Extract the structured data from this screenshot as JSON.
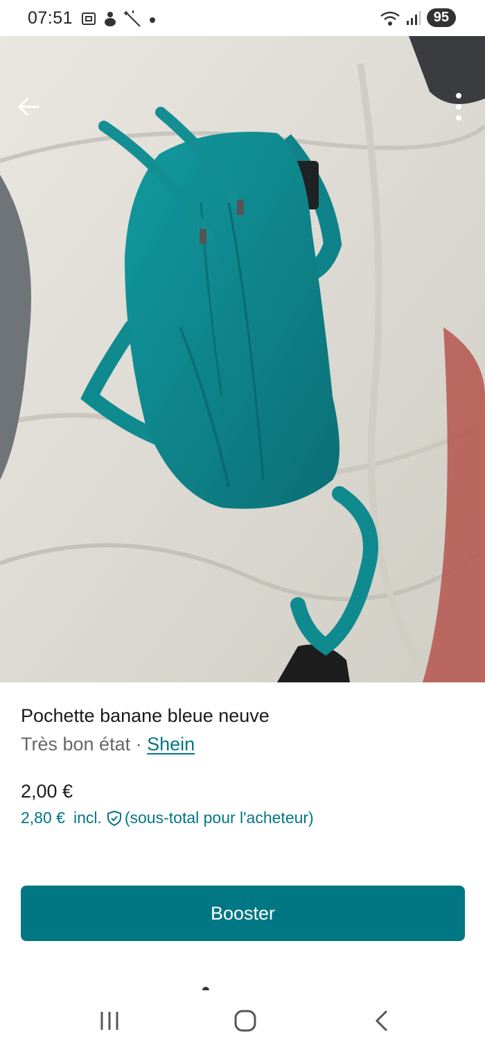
{
  "status_bar": {
    "time": "07:51",
    "battery": "95",
    "icons": [
      "screenshot-icon",
      "notification-app-icon",
      "magic-wand-icon",
      "dot-icon",
      "wifi-icon",
      "signal-icon"
    ]
  },
  "header": {
    "back_icon": "arrow-left-icon",
    "more_icon": "more-vertical-icon"
  },
  "gallery": {
    "image_count": 2,
    "active_index": 0
  },
  "item": {
    "title": "Pochette banane bleue neuve",
    "condition": "Très bon état",
    "separator": " · ",
    "brand": "Shein",
    "price": "2,00 €",
    "buyer_total": "2,80 €",
    "buyer_incl": "incl.",
    "buyer_note": "(sous-total pour l'acheteur)"
  },
  "actions": {
    "boost_label": "Booster"
  },
  "colors": {
    "accent": "#007782",
    "bag": "#0f8a8f"
  },
  "nav": {
    "items": [
      "recent-apps-icon",
      "home-icon",
      "back-icon"
    ]
  }
}
